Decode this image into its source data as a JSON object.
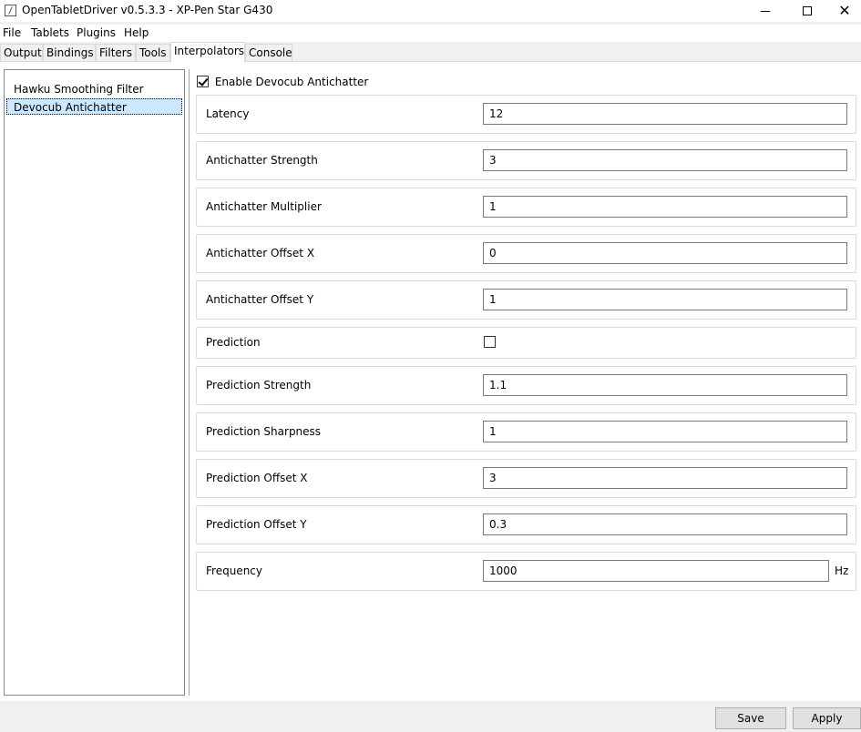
{
  "window": {
    "title": "OpenTabletDriver v0.5.3.3 - XP-Pen Star G430"
  },
  "menu": [
    "File",
    "Tablets",
    "Plugins",
    "Help"
  ],
  "tabs": [
    "Output",
    "Bindings",
    "Filters",
    "Tools",
    "Interpolators",
    "Console"
  ],
  "active_tab": "Interpolators",
  "plugins": [
    {
      "name": "Hawku Smoothing Filter",
      "selected": false
    },
    {
      "name": "Devocub Antichatter",
      "selected": true
    }
  ],
  "enable": {
    "label": "Enable Devocub Antichatter",
    "checked": true
  },
  "settings": [
    {
      "label": "Latency",
      "value": "12"
    },
    {
      "label": "Antichatter Strength",
      "value": "3"
    },
    {
      "label": "Antichatter Multiplier",
      "value": "1"
    },
    {
      "label": "Antichatter Offset X",
      "value": "0"
    },
    {
      "label": "Antichatter Offset Y",
      "value": "1"
    },
    {
      "label": "Prediction",
      "checked": false
    },
    {
      "label": "Prediction Strength",
      "value": "1.1"
    },
    {
      "label": "Prediction Sharpness",
      "value": "1"
    },
    {
      "label": "Prediction Offset X",
      "value": "3"
    },
    {
      "label": "Prediction Offset Y",
      "value": "0.3"
    },
    {
      "label": "Frequency",
      "value": "1000",
      "unit": "Hz"
    }
  ],
  "buttons": {
    "save": "Save",
    "apply": "Apply"
  }
}
